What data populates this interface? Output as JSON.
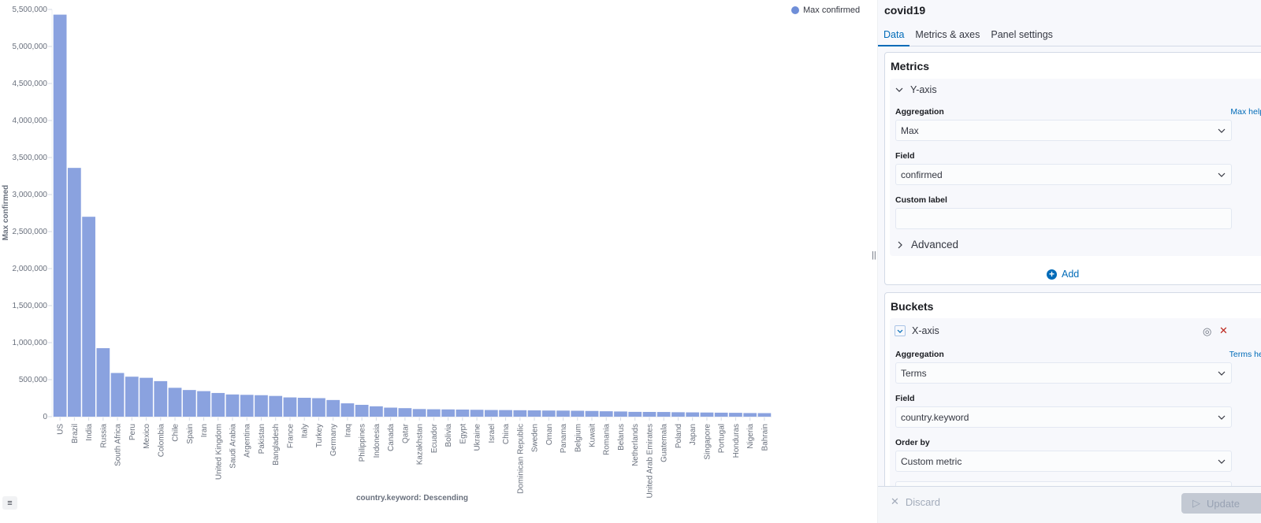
{
  "chart_data": {
    "type": "bar",
    "title": "",
    "xlabel": "country.keyword: Descending",
    "ylabel": "Max confirmed",
    "ylim": [
      0,
      5500000
    ],
    "yticks": [
      0,
      500000,
      1000000,
      1500000,
      2000000,
      2500000,
      3000000,
      3500000,
      4000000,
      4500000,
      5000000,
      5500000
    ],
    "ytick_labels": [
      "0",
      "500,000",
      "1,000,000",
      "1,500,000",
      "2,000,000",
      "2,500,000",
      "3,000,000",
      "3,500,000",
      "4,000,000",
      "4,500,000",
      "5,000,000",
      "5,500,000"
    ],
    "grid": false,
    "legend": {
      "position": "top-right",
      "entries": [
        {
          "name": "Max confirmed",
          "color": "#6092c0"
        }
      ]
    },
    "bar_color": "#8aa2df",
    "categories": [
      "US",
      "Brazil",
      "India",
      "Russia",
      "South Africa",
      "Peru",
      "Mexico",
      "Colombia",
      "Chile",
      "Spain",
      "Iran",
      "United Kingdom",
      "Saudi Arabia",
      "Argentina",
      "Pakistan",
      "Bangladesh",
      "France",
      "Italy",
      "Turkey",
      "Germany",
      "Iraq",
      "Philippines",
      "Indonesia",
      "Canada",
      "Qatar",
      "Kazakhstan",
      "Ecuador",
      "Bolivia",
      "Egypt",
      "Ukraine",
      "Israel",
      "China",
      "Dominican Republic",
      "Sweden",
      "Oman",
      "Panama",
      "Belgium",
      "Kuwait",
      "Romania",
      "Belarus",
      "Netherlands",
      "United Arab Emirates",
      "Guatemala",
      "Poland",
      "Japan",
      "Singapore",
      "Portugal",
      "Honduras",
      "Nigeria",
      "Bahrain"
    ],
    "series": [
      {
        "name": "Max confirmed",
        "values": [
          5430000,
          3360000,
          2700000,
          925000,
          590000,
          540000,
          525000,
          480000,
          390000,
          360000,
          345000,
          320000,
          300000,
          295000,
          290000,
          280000,
          260000,
          255000,
          250000,
          225000,
          180000,
          160000,
          140000,
          122000,
          115000,
          103000,
          100000,
          98000,
          96000,
          93000,
          90000,
          89000,
          87000,
          85000,
          83000,
          82000,
          80000,
          77000,
          73000,
          70000,
          65000,
          64000,
          63000,
          60000,
          58000,
          56000,
          54000,
          52000,
          49000,
          48000
        ]
      }
    ]
  },
  "legend_toggle_icon": "list-icon",
  "sidebar": {
    "title": "covid19",
    "tabs": [
      {
        "label": "Data",
        "active": true
      },
      {
        "label": "Metrics & axes",
        "active": false
      },
      {
        "label": "Panel settings",
        "active": false
      }
    ],
    "metrics": {
      "title": "Metrics",
      "y_axis_label": "Y-axis",
      "aggregation_label": "Aggregation",
      "aggregation_help": "Max help",
      "aggregation_value": "Max",
      "field_label": "Field",
      "field_value": "confirmed",
      "custom_label_label": "Custom label",
      "custom_label_value": "",
      "advanced_label": "Advanced",
      "add_label": "Add"
    },
    "buckets": {
      "title": "Buckets",
      "x_axis_label": "X-axis",
      "aggregation_label": "Aggregation",
      "aggregation_help": "Terms help",
      "aggregation_value": "Terms",
      "field_label": "Field",
      "field_value": "country.keyword",
      "order_by_label": "Order by",
      "order_by_value": "Custom metric"
    },
    "discard_label": "Discard",
    "update_label": "Update"
  },
  "colors": {
    "accent": "#006bb8",
    "danger": "#bd271e"
  }
}
